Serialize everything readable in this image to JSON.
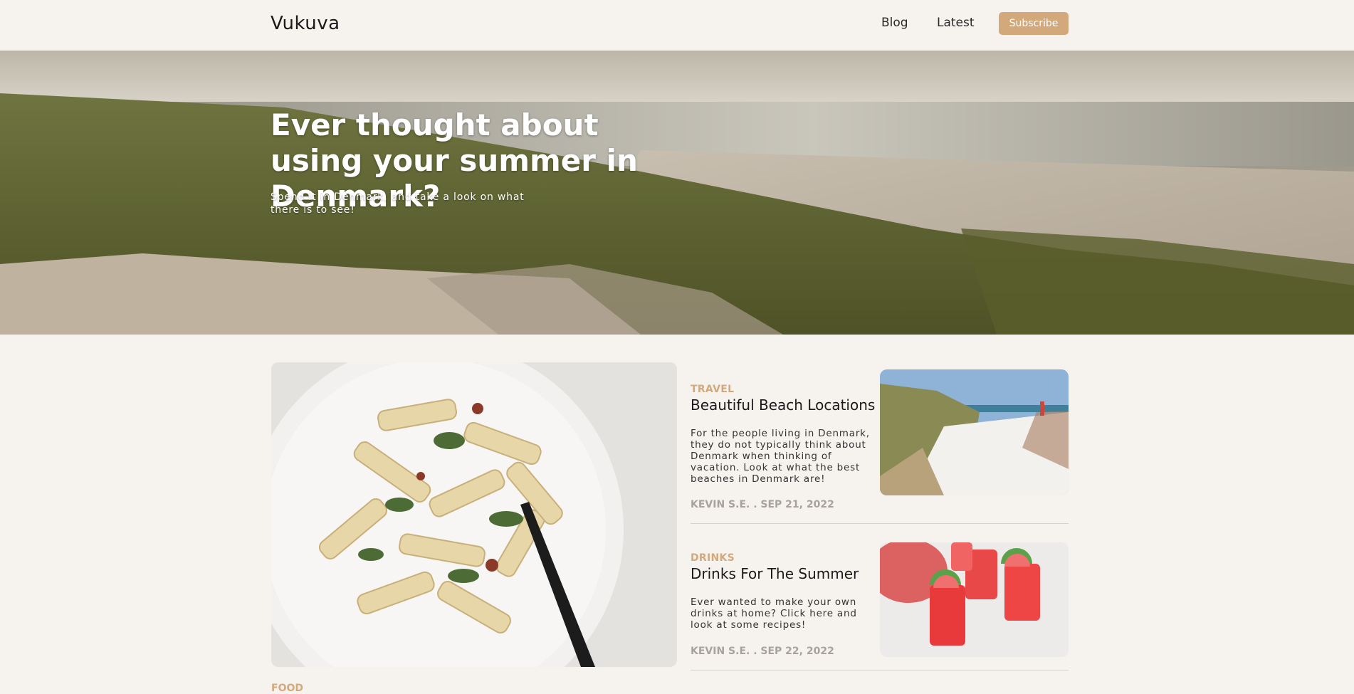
{
  "header": {
    "logo": "Vukuva",
    "nav": {
      "blog": "Blog",
      "latest": "Latest"
    },
    "subscribe_label": "Subscribe"
  },
  "hero": {
    "title": "Ever thought about using your summer in Denmark?",
    "subtitle": "Spend it in Denmark, and take a look on what there is to see!"
  },
  "posts": [
    {
      "category": "TRAVEL",
      "title": "Beautiful Beach Locations",
      "body": "For the people living in Denmark, they do not typically think about Denmark when thinking of vacation. Look at what the best beaches in Denmark are!",
      "meta": "KEVIN S.E. . SEP 21, 2022"
    },
    {
      "category": "DRINKS",
      "title": "Drinks For The Summer",
      "body": "Ever wanted to make your own drinks at home? Click here and look at some recipes!",
      "meta": "KEVIN S.E. . SEP 22, 2022"
    }
  ],
  "next_section_label": "FOOD",
  "colors": {
    "accent": "#d3a97c",
    "background": "#f6f3ef",
    "meta": "#a8a29c"
  }
}
